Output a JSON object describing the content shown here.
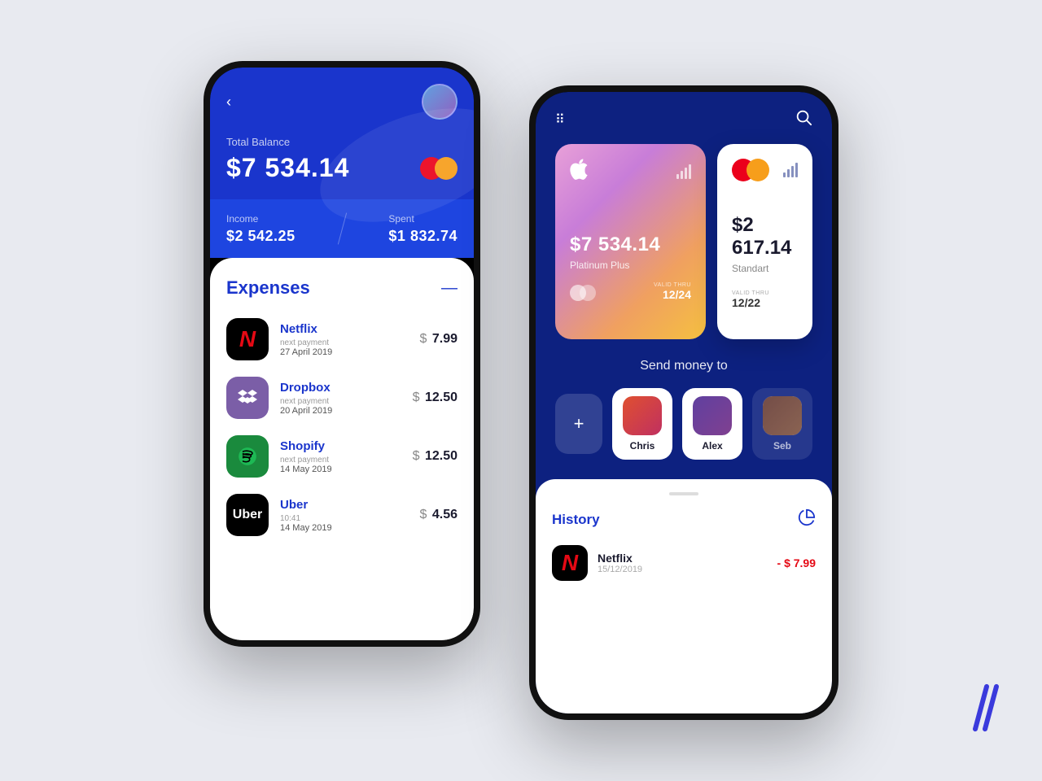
{
  "background": "#e8eaf0",
  "phone1": {
    "back_label": "‹",
    "balance_label": "Total Balance",
    "balance_amount": "$7 534.14",
    "income_label": "Income",
    "income_amount": "$2 542.25",
    "spent_label": "Spent",
    "spent_amount": "$1 832.74",
    "expenses_title": "Expenses",
    "expenses": [
      {
        "name": "Netflix",
        "sub": "next payment",
        "date": "27 April 2019",
        "amount": "7.99",
        "icon_type": "netflix"
      },
      {
        "name": "Dropbox",
        "sub": "next payment",
        "date": "20 April 2019",
        "amount": "12.50",
        "icon_type": "dropbox"
      },
      {
        "name": "Shopify",
        "sub": "next payment",
        "date": "14 May 2019",
        "amount": "12.50",
        "icon_type": "shopify"
      },
      {
        "name": "Uber",
        "sub": "10:41",
        "date": "14 May 2019",
        "amount": "4.56",
        "icon_type": "uber"
      }
    ]
  },
  "phone2": {
    "card_apple_amount": "$7 534.14",
    "card_apple_type": "Platinum Plus",
    "card_apple_valid_label": "VALID THRU",
    "card_apple_valid": "12/24",
    "card_mc_amount": "$2 617.14",
    "card_mc_type": "Standart",
    "card_mc_valid_label": "VALID THRU",
    "card_mc_valid": "12/22",
    "send_money_label": "Send money to",
    "contacts": [
      {
        "name": "Chris"
      },
      {
        "name": "Alex"
      },
      {
        "name": "Seb"
      }
    ],
    "history_title": "History",
    "history_items": [
      {
        "name": "Netflix",
        "date": "15/12/2019",
        "amount": "- $ 7.99"
      }
    ]
  }
}
